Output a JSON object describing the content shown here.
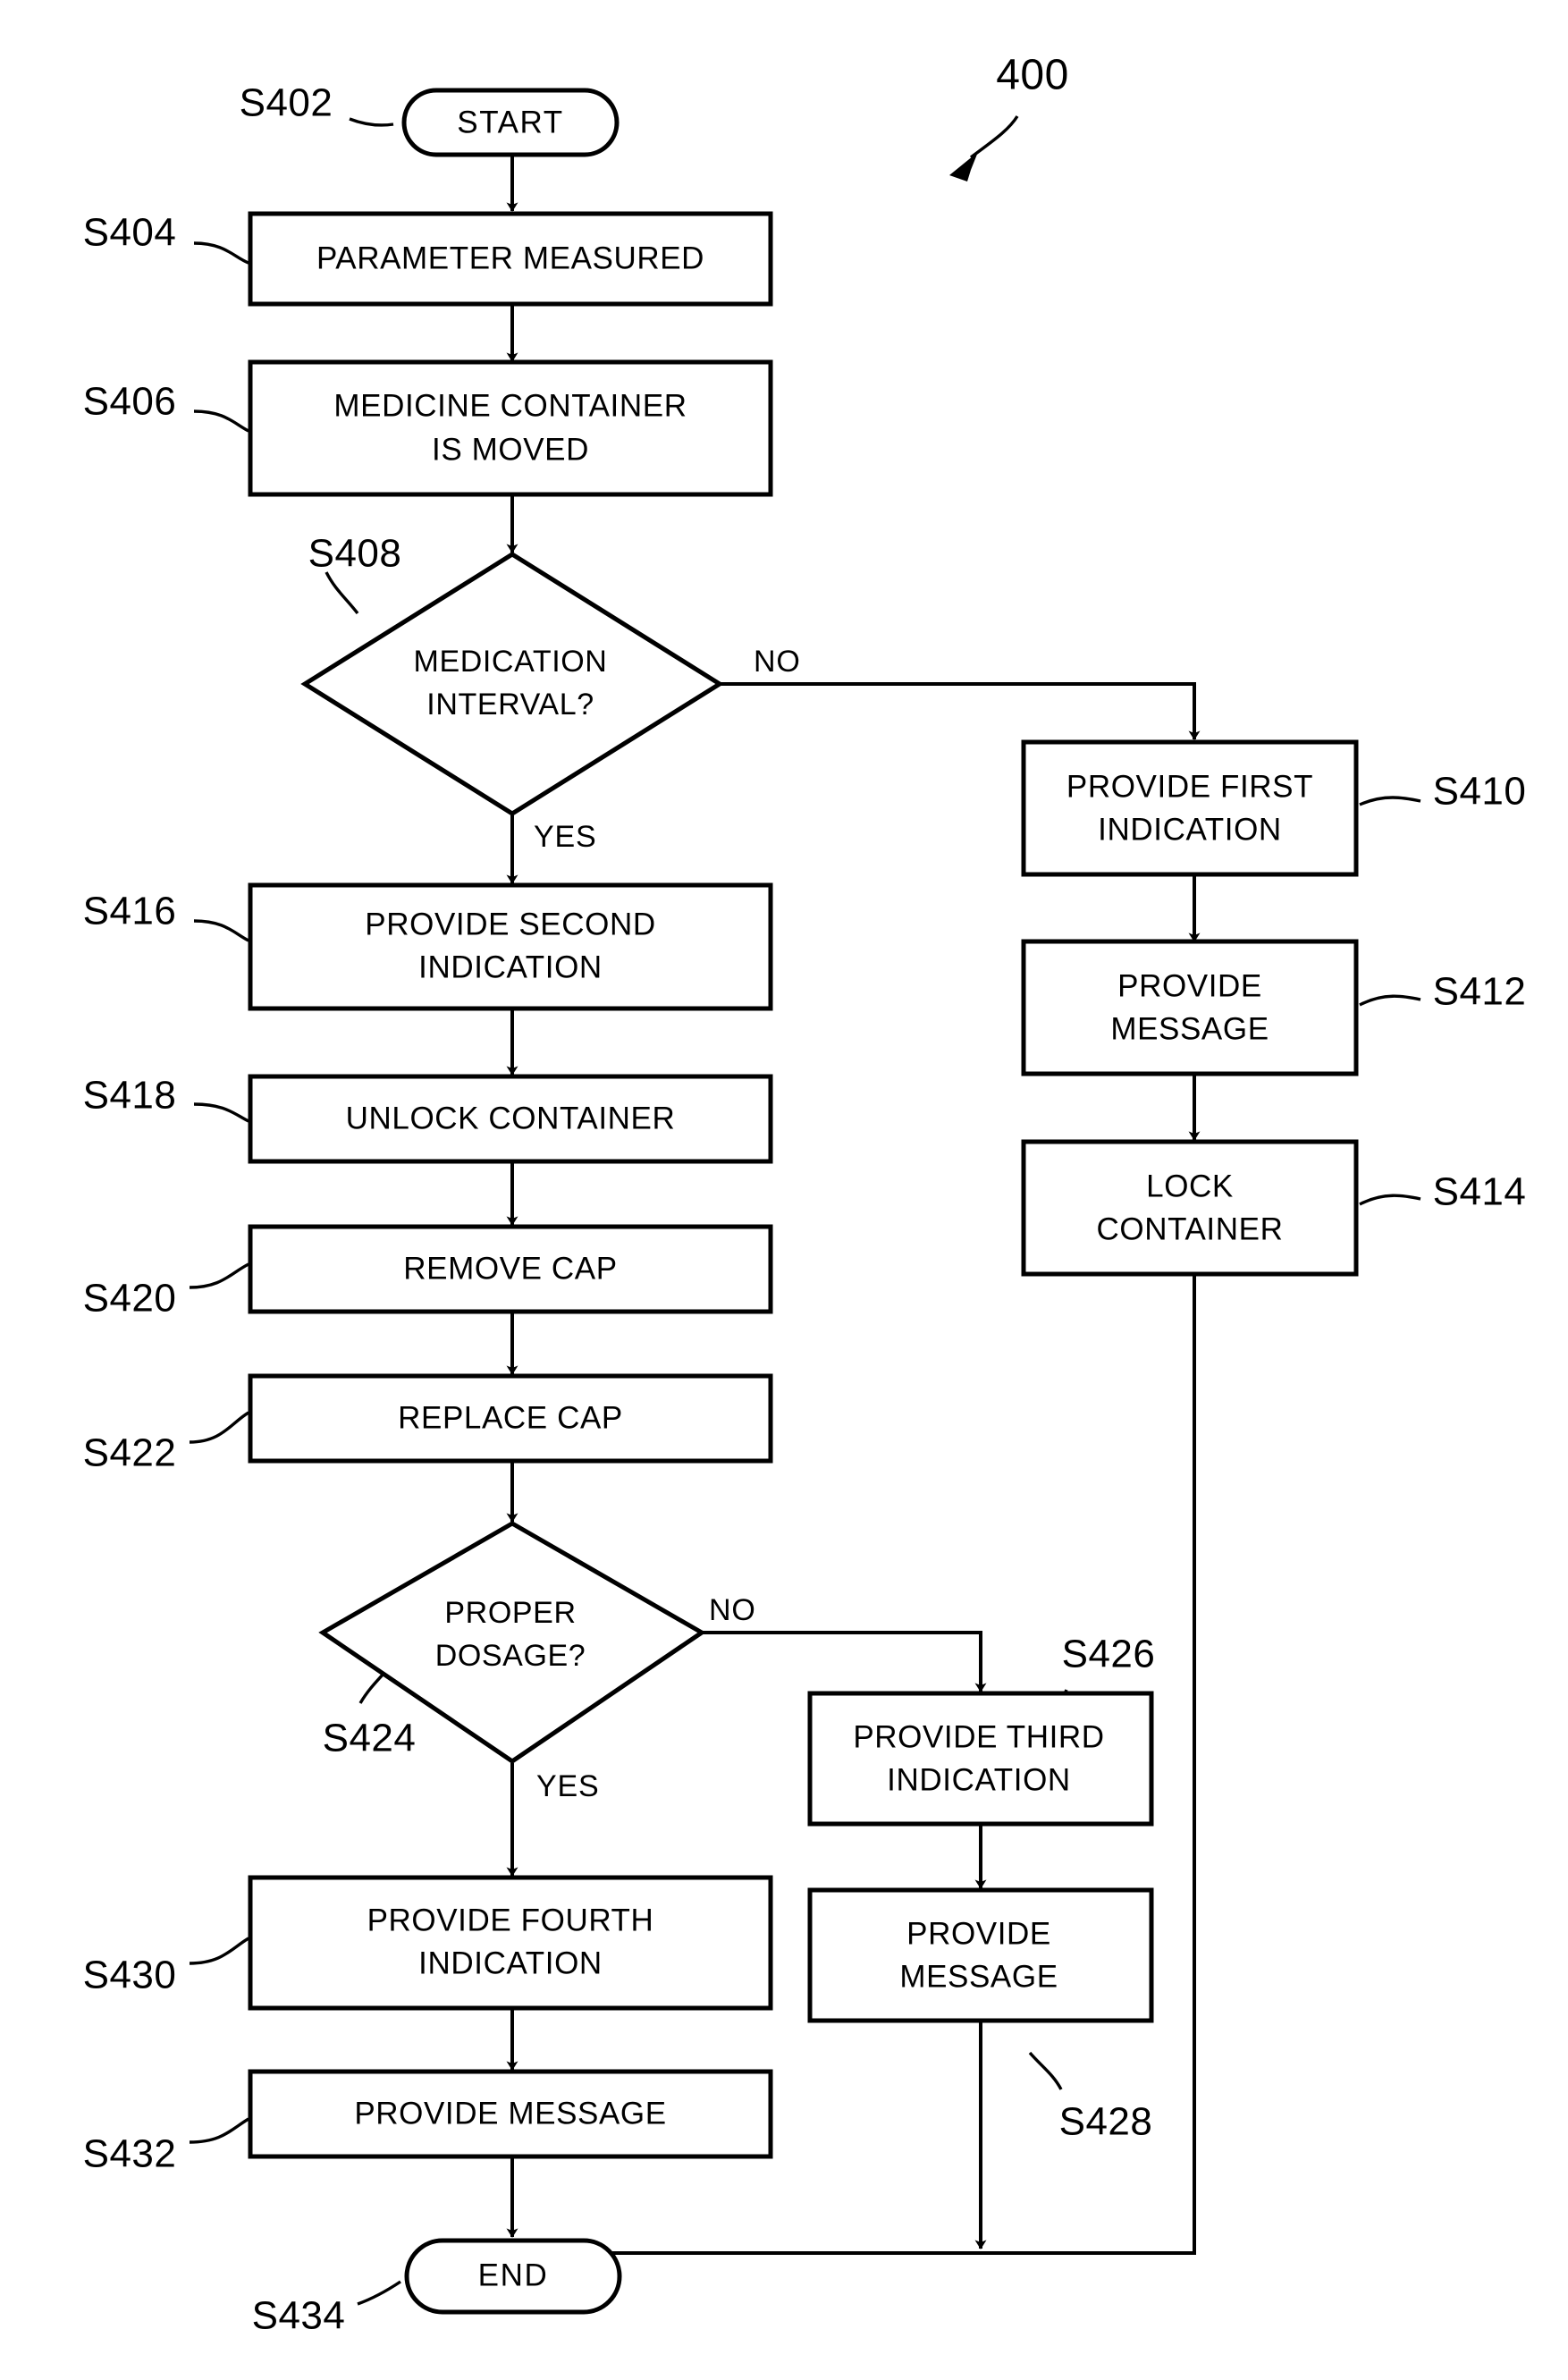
{
  "figure": {
    "number": "400"
  },
  "nodes": [
    {
      "ref": "S402",
      "type": "terminal",
      "text": "START"
    },
    {
      "ref": "S404",
      "type": "process",
      "line1": "PARAMETER MEASURED",
      "line2": ""
    },
    {
      "ref": "S406",
      "type": "process",
      "line1": "MEDICINE CONTAINER",
      "line2": "IS MOVED"
    },
    {
      "ref": "S408",
      "type": "decision",
      "line1": "MEDICATION",
      "line2": "INTERVAL?"
    },
    {
      "ref": "S410",
      "type": "process",
      "line1": "PROVIDE FIRST",
      "line2": "INDICATION"
    },
    {
      "ref": "S412",
      "type": "process",
      "line1": "PROVIDE",
      "line2": "MESSAGE"
    },
    {
      "ref": "S414",
      "type": "process",
      "line1": "LOCK",
      "line2": "CONTAINER"
    },
    {
      "ref": "S416",
      "type": "process",
      "line1": "PROVIDE SECOND",
      "line2": "INDICATION"
    },
    {
      "ref": "S418",
      "type": "process",
      "line1": "UNLOCK CONTAINER",
      "line2": ""
    },
    {
      "ref": "S420",
      "type": "process",
      "line1": "REMOVE CAP",
      "line2": ""
    },
    {
      "ref": "S422",
      "type": "process",
      "line1": "REPLACE CAP",
      "line2": ""
    },
    {
      "ref": "S424",
      "type": "decision",
      "line1": "PROPER",
      "line2": "DOSAGE?"
    },
    {
      "ref": "S426",
      "type": "process",
      "line1": "PROVIDE THIRD",
      "line2": "INDICATION"
    },
    {
      "ref": "S428",
      "type": "process",
      "line1": "PROVIDE",
      "line2": "MESSAGE"
    },
    {
      "ref": "S430",
      "type": "process",
      "line1": "PROVIDE FOURTH",
      "line2": "INDICATION"
    },
    {
      "ref": "S432",
      "type": "process",
      "line1": "PROVIDE MESSAGE",
      "line2": ""
    },
    {
      "ref": "S434",
      "type": "terminal",
      "text": "END"
    }
  ],
  "branch_labels": {
    "s408_no": "NO",
    "s408_yes": "YES",
    "s424_no": "NO",
    "s424_yes": "YES"
  },
  "colors": {
    "stroke": "#000000",
    "fill": "#ffffff",
    "background": "#ffffff"
  }
}
